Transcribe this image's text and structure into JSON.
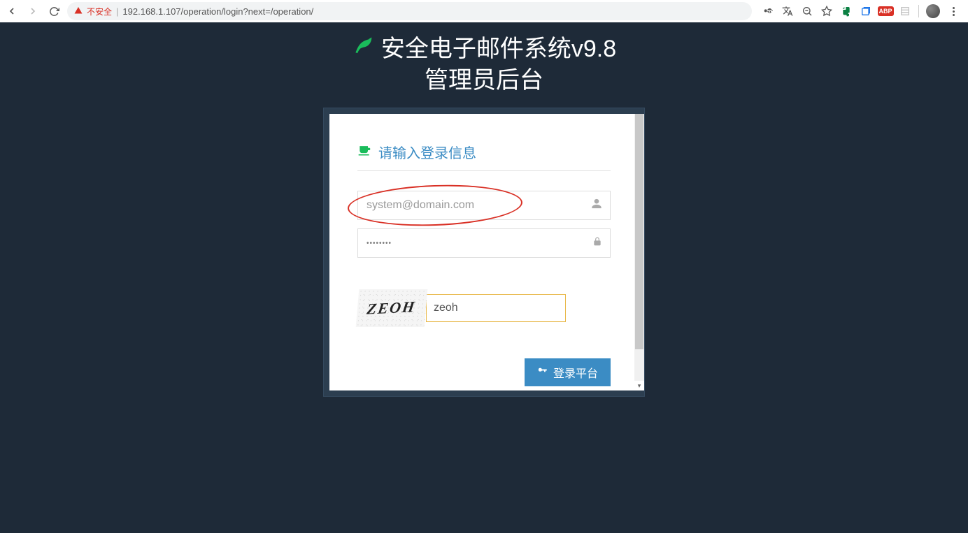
{
  "browser": {
    "insecure_label": "不安全",
    "url": "192.168.1.107/operation/login?next=/operation/"
  },
  "page": {
    "title_line1": "安全电子邮件系统v9.8",
    "title_line2": "管理员后台"
  },
  "login_panel": {
    "header": "请输入登录信息",
    "username": {
      "placeholder": "system@domain.com",
      "value": ""
    },
    "password": {
      "value": "••••••••"
    },
    "captcha": {
      "image_text": "ZEOH",
      "input_value": "zeoh"
    },
    "login_button": "登录平台"
  }
}
